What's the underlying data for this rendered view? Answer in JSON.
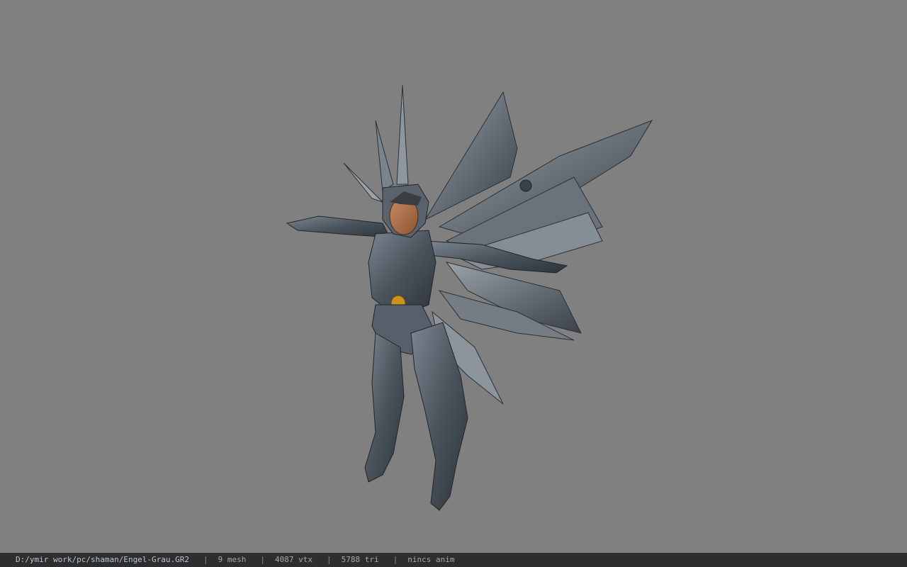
{
  "viewer": {
    "background_color": "#808080",
    "model_icon": "winged-armored-character"
  },
  "status_bar": {
    "file_path": "D:/ymir work/pc/shaman/Engel-Grau.GR2",
    "separator": "|",
    "mesh_count": "9 mesh",
    "vertex_count": "4087 vtx",
    "triangle_count": "5788 tri",
    "animation": "nincs anim"
  }
}
